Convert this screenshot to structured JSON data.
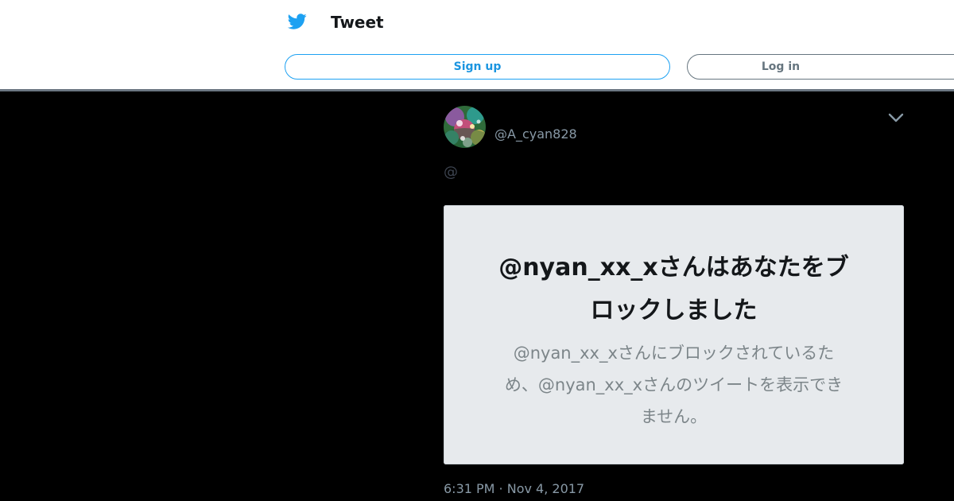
{
  "header": {
    "title": "Tweet",
    "logo_icon": "twitter-bird-icon",
    "brand_color": "#1da1f2"
  },
  "auth": {
    "signup_label": "Sign up",
    "login_label": "Log in"
  },
  "tweet": {
    "handle": "@A_cyan828",
    "text": "@",
    "menu_icon": "chevron-down-icon",
    "timestamp": "6:31 PM · Nov 4, 2017",
    "media": {
      "heading_lines": [
        "@nyan_xx_xさんはあなたをブ",
        "ロックしました"
      ],
      "body_lines": [
        "@nyan_xx_xさんにブロックされているた",
        "め、@nyan_xx_xさんのツイートを表示でき",
        "ません。"
      ]
    }
  }
}
